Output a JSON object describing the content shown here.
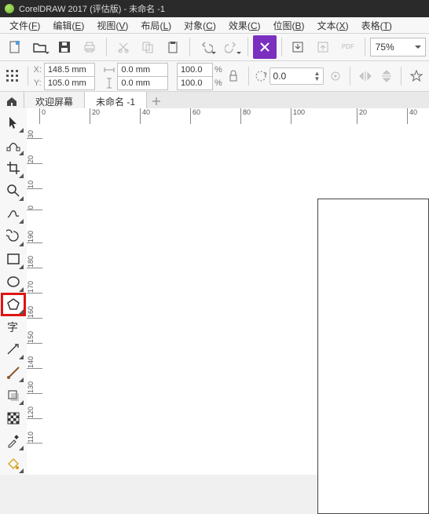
{
  "title": "CorelDRAW 2017 (评估版) - 未命名 -1",
  "menu": [
    {
      "label": "文件",
      "m": "F"
    },
    {
      "label": "编辑",
      "m": "E"
    },
    {
      "label": "视图",
      "m": "V"
    },
    {
      "label": "布局",
      "m": "L"
    },
    {
      "label": "对象",
      "m": "C"
    },
    {
      "label": "效果",
      "m": "C"
    },
    {
      "label": "位图",
      "m": "B"
    },
    {
      "label": "文本",
      "m": "X"
    },
    {
      "label": "表格",
      "m": "T"
    }
  ],
  "toolbar1": {
    "zoom": "75%",
    "pdf_label": "PDF"
  },
  "prop": {
    "x_label": "X:",
    "y_label": "Y:",
    "x": "148.5 mm",
    "y": "105.0 mm",
    "w": "0.0 mm",
    "h": "0.0 mm",
    "sx": "100.0",
    "sy": "100.0",
    "rot": "0.0"
  },
  "tabs": {
    "welcome": "欢迎屏幕",
    "doc": "未命名 -1"
  },
  "ruler_h": [
    "0",
    "20",
    "40",
    "60",
    "80",
    "100",
    "20",
    "40"
  ],
  "ruler_v": [
    "30",
    "20",
    "10",
    "0",
    "190",
    "180",
    "170",
    "160",
    "150",
    "140",
    "130",
    "120",
    "110"
  ],
  "tools": {
    "pick": "pick-tool",
    "shape": "shape-tool",
    "crop": "crop-tool",
    "zoom": "zoom-tool",
    "freehand": "freehand-tool",
    "artistic": "artistic-media-tool",
    "rectangle": "rectangle-tool",
    "ellipse": "ellipse-tool",
    "polygon": "polygon-tool",
    "text": "text-tool",
    "parallel": "parallel-dimension-tool",
    "connector": "connector-tool",
    "dropshadow": "drop-shadow-tool",
    "transparency": "transparency-tool",
    "eyedropper": "color-eyedropper-tool"
  }
}
